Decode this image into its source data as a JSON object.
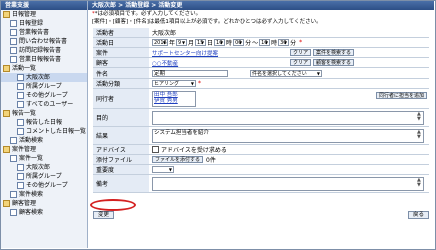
{
  "sidebar": {
    "header": "営業支援",
    "items": [
      {
        "label": "日報管理",
        "indent": 0
      },
      {
        "label": "日報登録",
        "indent": 1
      },
      {
        "label": "営業報告書",
        "indent": 1
      },
      {
        "label": "問い合わせ報告書",
        "indent": 1
      },
      {
        "label": "訪問記録報告書",
        "indent": 1
      },
      {
        "label": "営業日報報告書",
        "indent": 1
      },
      {
        "label": "活動一覧",
        "indent": 0
      },
      {
        "label": "大阪次郎",
        "indent": 2,
        "selected": true
      },
      {
        "label": "所属グループ",
        "indent": 2
      },
      {
        "label": "その他グループ",
        "indent": 2
      },
      {
        "label": "すべてのユーザー",
        "indent": 2
      },
      {
        "label": "報告一覧",
        "indent": 0
      },
      {
        "label": "報告した日報",
        "indent": 2
      },
      {
        "label": "コメントした日報一覧",
        "indent": 2
      },
      {
        "label": "活動検索",
        "indent": 1
      },
      {
        "label": "案件管理",
        "indent": 0
      },
      {
        "label": "案件一覧",
        "indent": 1
      },
      {
        "label": "大阪次郎",
        "indent": 2
      },
      {
        "label": "所属グループ",
        "indent": 2
      },
      {
        "label": "その他グループ",
        "indent": 2
      },
      {
        "label": "案件検索",
        "indent": 1
      },
      {
        "label": "顧客管理",
        "indent": 0
      },
      {
        "label": "顧客検索",
        "indent": 1
      }
    ]
  },
  "header": {
    "title": "大阪次郎 > 活動登録 > 活動変更"
  },
  "notes": [
    "*は必須項目です。必ず入力してください。",
    "[案件]・[顧客]・[件名]は最低1項目以上が必須です。どれかひとつは必ず入力してください。"
  ],
  "form": {
    "owner": {
      "label": "活動者",
      "value": "大阪次郎"
    },
    "date": {
      "label": "活動日",
      "year": "2016",
      "month": "9",
      "day": "15",
      "start_hour": "10",
      "start_min": "00",
      "end_hour": "10",
      "end_min": "30",
      "unit_year": "年",
      "unit_month": "月",
      "unit_day": "日",
      "unit_hour": "時",
      "unit_min": "分",
      "sep": "～"
    },
    "project": {
      "label": "案件",
      "value": "サポートセンター向け提案",
      "clear": "クリア",
      "search": "案件を検索する"
    },
    "customer": {
      "label": "顧客",
      "value": "○○不動産",
      "clear": "クリア",
      "search": "顧客を検索する"
    },
    "subject": {
      "label": "件名",
      "value": "定期",
      "select": "件名を選択してください"
    },
    "type": {
      "label": "活動分類",
      "value": "ヒアリング"
    },
    "attendees": {
      "label": "同行者",
      "names": [
        "田中 吾郎",
        "伊賀 秀男"
      ],
      "button": "同行者に担当を追加"
    },
    "purpose": {
      "label": "目的",
      "value": ""
    },
    "result": {
      "label": "結果",
      "value": "システム担当者を紹介"
    },
    "advice": {
      "label": "アドバイス",
      "checkbox": "アドバイスを受け求める"
    },
    "attach": {
      "label": "添付ファイル",
      "button": "ファイルを添付する",
      "size": "0件"
    },
    "importance": {
      "label": "重要度",
      "value": ""
    },
    "memo": {
      "label": "備考",
      "value": ""
    }
  },
  "footer": {
    "submit": "変更",
    "back": "戻る"
  },
  "colors": {
    "header": "#2d4f86",
    "label_bg": "#e4ebf5",
    "highlight": "#d42020"
  }
}
